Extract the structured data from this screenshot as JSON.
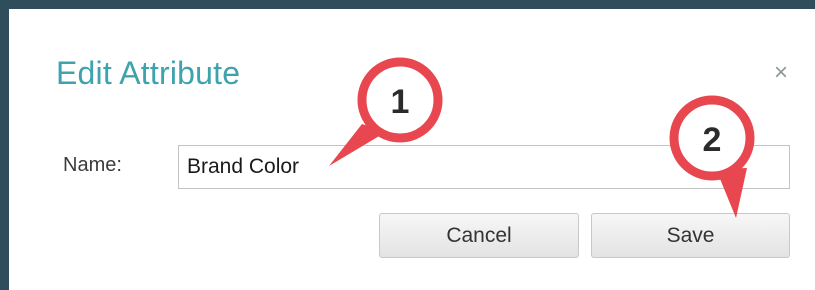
{
  "dialog": {
    "title": "Edit Attribute",
    "close_symbol": "×",
    "name_label": "Name:",
    "name_value": "Brand Color",
    "cancel_label": "Cancel",
    "save_label": "Save"
  },
  "callouts": [
    {
      "number": "1",
      "points_to": "name-input"
    },
    {
      "number": "2",
      "points_to": "save-button"
    }
  ],
  "colors": {
    "title": "#3fa3ad",
    "frame_border": "#2f4d5b",
    "callout_ring": "#e8474f",
    "callout_fill": "#ffffff"
  }
}
